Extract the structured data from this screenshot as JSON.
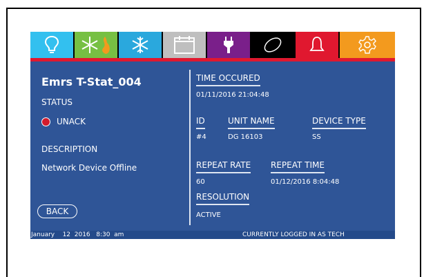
{
  "tabs": [
    {
      "name": "lighting",
      "icon": "lightbulb-icon",
      "bg": "#33c0ef",
      "width": 64
    },
    {
      "name": "heat-cool",
      "icon": "snowflake-flame-icon",
      "bg": "#77c043",
      "width": 64
    },
    {
      "name": "cooling",
      "icon": "snowflake-icon",
      "bg": "#2aa8dd",
      "width": 64
    },
    {
      "name": "schedule",
      "icon": "calendar-icon",
      "bg": "#bfbfbf",
      "width": 64
    },
    {
      "name": "power",
      "icon": "plug-icon",
      "bg": "#7a1f8a",
      "width": 64
    },
    {
      "name": "misc",
      "icon": "oval-icon",
      "bg": "#000000",
      "width": 64
    },
    {
      "name": "alarms",
      "icon": "bell-icon",
      "bg": "#e0182f",
      "width": 64
    },
    {
      "name": "settings",
      "icon": "gear-icon",
      "bg": "#f39a1e",
      "width": 80
    }
  ],
  "device": {
    "title": "Emrs T-Stat_004",
    "status_label": "STATUS",
    "status_value": "UNACK",
    "description_label": "DESCRIPTION",
    "description_value": "Network Device Offline"
  },
  "back_label": "BACK",
  "details": {
    "time_occured_label": "TIME OCCURED",
    "time_occured_value": "01/11/2016 21:04:48",
    "id_label": "ID",
    "id_value": "#4",
    "unit_name_label": "UNIT NAME",
    "unit_name_value": "DG 16103",
    "device_type_label": "DEVICE TYPE",
    "device_type_value": "SS",
    "repeat_rate_label": "REPEAT RATE",
    "repeat_rate_value": "60",
    "repeat_time_label": "REPEAT TIME",
    "repeat_time_value": "01/12/2016 8:04:48",
    "resolution_label": "RESOLUTION",
    "resolution_value": "ACTIVE"
  },
  "statusbar": {
    "date": "January    12  2016   8:30  am",
    "login": "CURRENTLY LOGGED IN AS TECH"
  },
  "colors": {
    "screen_bg": "#2f5597",
    "tab_underline": "#e0182f",
    "status_dot": "#d11b2d"
  }
}
